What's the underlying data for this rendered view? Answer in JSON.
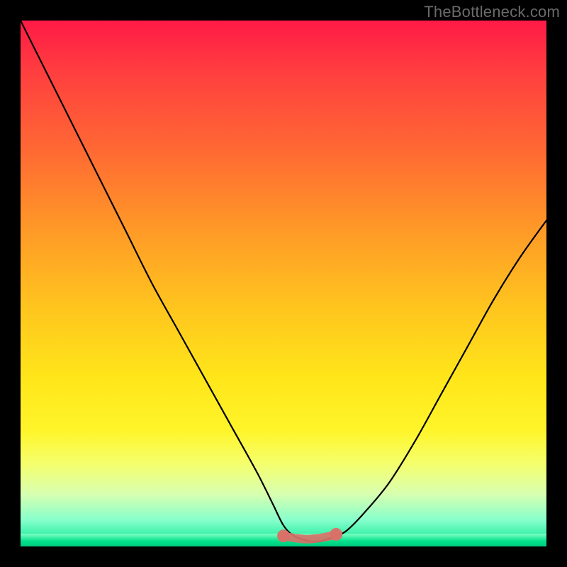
{
  "watermark": "TheBottleneck.com",
  "chart_data": {
    "type": "line",
    "title": "",
    "xlabel": "",
    "ylabel": "",
    "xlim": [
      0,
      100
    ],
    "ylim": [
      0,
      100
    ],
    "series": [
      {
        "name": "bottleneck-curve",
        "x": [
          0,
          5,
          10,
          15,
          20,
          25,
          30,
          35,
          40,
          45,
          48,
          50,
          52,
          55,
          57,
          60,
          62,
          65,
          70,
          75,
          80,
          85,
          90,
          95,
          100
        ],
        "y": [
          100,
          90,
          80,
          70,
          60,
          50,
          41,
          32,
          23,
          14,
          8,
          4,
          2,
          1,
          1,
          2,
          3,
          6,
          12,
          20,
          29,
          38,
          47,
          55,
          62
        ]
      },
      {
        "name": "low-bottleneck-marker",
        "x": [
          50,
          51,
          52,
          53,
          54,
          55,
          56,
          57,
          58,
          59,
          60
        ],
        "y": [
          2,
          1.8,
          1.6,
          1.5,
          1.4,
          1.4,
          1.5,
          1.6,
          1.8,
          2.0,
          2.3
        ]
      }
    ],
    "background_gradient": {
      "top": "#ff1a47",
      "mid": "#ffe61a",
      "bottom": "#00e58f"
    },
    "marker_color": "#d97168"
  }
}
